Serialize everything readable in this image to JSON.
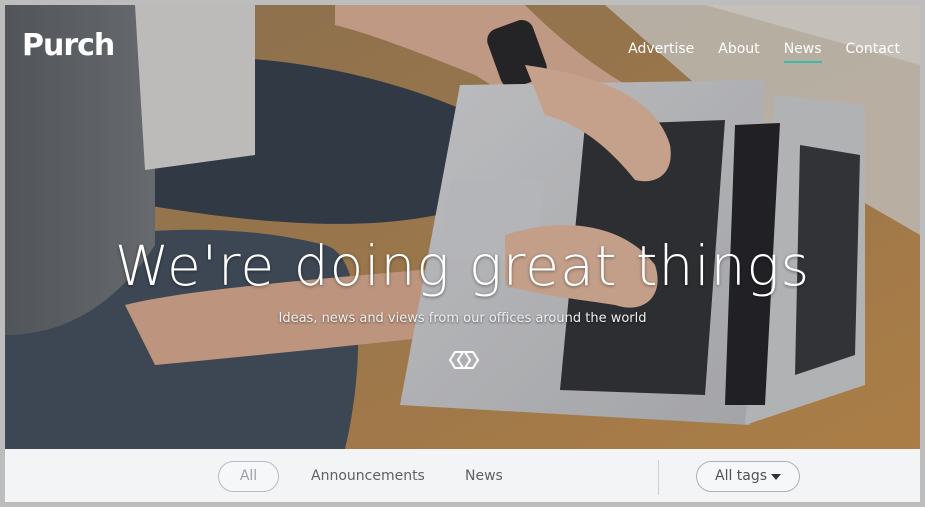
{
  "header": {
    "logo_text": "Purch",
    "nav": [
      {
        "label": "Advertise",
        "active": false
      },
      {
        "label": "About",
        "active": false
      },
      {
        "label": "News",
        "active": true
      },
      {
        "label": "Contact",
        "active": false
      }
    ],
    "accent_color": "#3fb8a6"
  },
  "hero": {
    "headline": "We're doing great things",
    "subheadline": "Ideas, news and views from our offices around the world",
    "emblem_icon": "linked-rings-icon",
    "background_image": "person-typing-on-laptop"
  },
  "filters": {
    "all_label": "All",
    "announcements_label": "Announcements",
    "news_label": "News",
    "tags_label": "All tags",
    "tags_icon": "caret-down-icon"
  }
}
